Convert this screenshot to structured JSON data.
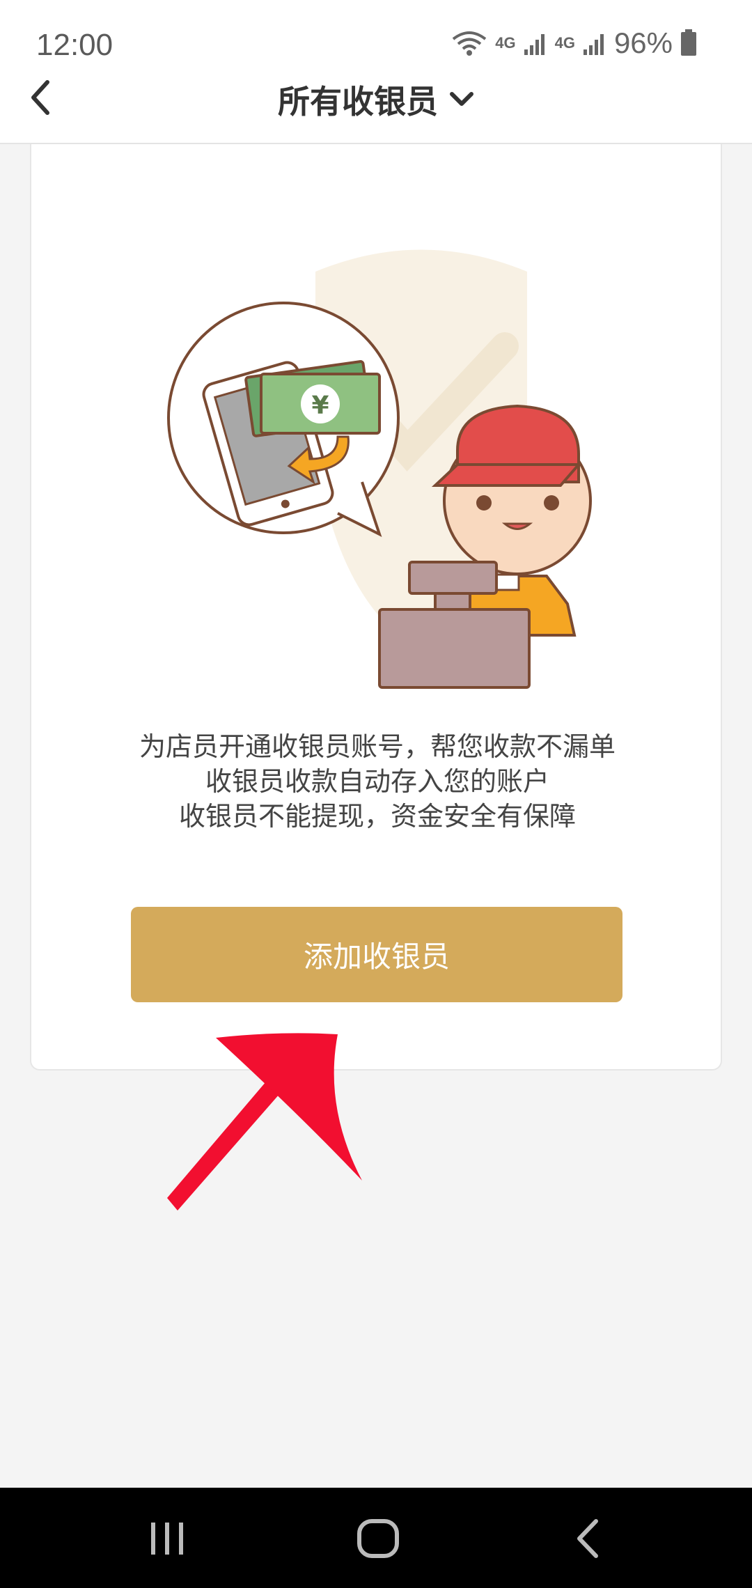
{
  "status_bar": {
    "time": "12:00",
    "battery": "96%",
    "network_label_1": "4G",
    "network_label_2": "4G",
    "icons": [
      "wifi-icon",
      "signal-icon",
      "signal-icon",
      "battery-icon"
    ]
  },
  "header": {
    "title": "所有收银员",
    "back_icon": "chevron-left-icon",
    "dropdown_icon": "chevron-down-icon"
  },
  "card": {
    "illustration": "cashier-illustration",
    "description_lines": [
      "为店员开通收银员账号，帮您收款不漏单",
      "收银员收款自动存入您的账户",
      "收银员不能提现，资金安全有保障"
    ],
    "add_button_label": "添加收银员"
  },
  "colors": {
    "accent": "#d4aa5b",
    "arrow": "#f20f30",
    "background": "#f4f4f4"
  },
  "navbar": {
    "icons": [
      "recent-apps-icon",
      "home-icon",
      "back-icon"
    ]
  }
}
